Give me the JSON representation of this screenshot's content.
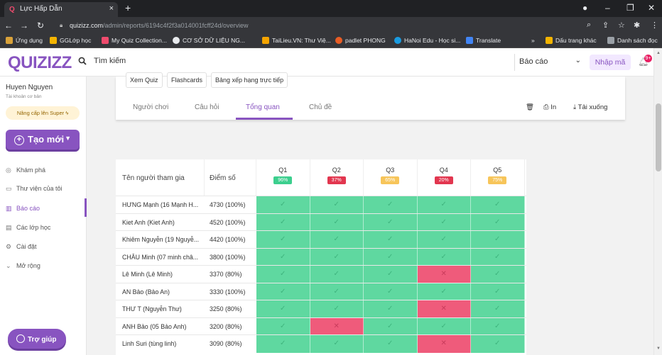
{
  "browser": {
    "tab_title": "Lực Hấp Dẫn",
    "url_host": "quizizz.com",
    "url_path": "/admin/reports/6194c4f2f3a014001fcff24d/overview",
    "bookmarks": [
      "Ứng dụng",
      "GGLớp học",
      "My Quiz Collection...",
      "CƠ SỞ DỮ LIỆU NG...",
      "TaiLieu.VN: Thư Việ...",
      "padlet PHONG",
      "HaNoi Edu - Học si...",
      "Translate",
      "Dấu trang khác",
      "Danh sách đọc"
    ]
  },
  "header": {
    "logo": "QUIZIZZ",
    "search_text": "Tìm kiếm",
    "report_select": "Báo cáo",
    "join_button": "Nhập mã",
    "notification_count": "9+"
  },
  "sidebar": {
    "user_name": "Huyen Nguyen",
    "account_type": "Tài khoản cơ bản",
    "upgrade": "Nâng cấp lên Super",
    "create_button": "Tạo mới",
    "items": [
      {
        "label": "Khám phá",
        "icon": "compass-icon"
      },
      {
        "label": "Thư viện của tôi",
        "icon": "folder-icon"
      },
      {
        "label": "Báo cáo",
        "icon": "chart-icon"
      },
      {
        "label": "Các lớp học",
        "icon": "classroom-icon"
      },
      {
        "label": "Cài đặt",
        "icon": "gear-icon"
      },
      {
        "label": "Mở rộng",
        "icon": "chevron-down-icon"
      }
    ],
    "help_button": "Trợ giúp"
  },
  "report": {
    "chips": [
      "Xem Quiz",
      "Flashcards",
      "Bảng xếp hạng trực tiếp"
    ],
    "tabs": [
      "Người chơi",
      "Câu hỏi",
      "Tổng quan",
      "Chủ đề"
    ],
    "active_tab": "Tổng quan",
    "print_label": "In",
    "download_label": "Tải xuống"
  },
  "table": {
    "col_name": "Tên người tham gia",
    "col_score": "Điểm số",
    "questions": [
      {
        "label": "Q1",
        "pct": "96%",
        "color": "#3ccf8e"
      },
      {
        "label": "Q2",
        "pct": "37%",
        "color": "#e2364f"
      },
      {
        "label": "Q3",
        "pct": "65%",
        "color": "#f7c55a"
      },
      {
        "label": "Q4",
        "pct": "20%",
        "color": "#e2364f"
      },
      {
        "label": "Q5",
        "pct": "75%",
        "color": "#f7c55a"
      }
    ],
    "rows": [
      {
        "name": "HƯNG Mạnh (16 Mạnh H...",
        "score": "4730 (100%)",
        "answers": [
          "ok",
          "ok",
          "ok",
          "ok",
          "ok"
        ]
      },
      {
        "name": "Kiet Anh (Kiet Anh)",
        "score": "4520 (100%)",
        "answers": [
          "ok",
          "ok",
          "ok",
          "ok",
          "ok"
        ]
      },
      {
        "name": "Khiêm Nguyễn (19 Nguyễ...",
        "score": "4420 (100%)",
        "answers": [
          "ok",
          "ok",
          "ok",
          "ok",
          "ok"
        ]
      },
      {
        "name": "CHÂU Minh (07 minh châ...",
        "score": "3800 (100%)",
        "answers": [
          "ok",
          "ok",
          "ok",
          "ok",
          "ok"
        ]
      },
      {
        "name": "Lê Minh (Lê Minh)",
        "score": "3370 (80%)",
        "answers": [
          "ok",
          "ok",
          "ok",
          "bad",
          "ok"
        ]
      },
      {
        "name": "AN Bảo (Bảo An)",
        "score": "3330 (100%)",
        "answers": [
          "ok",
          "ok",
          "ok",
          "ok",
          "ok"
        ]
      },
      {
        "name": "THƯ T (Nguyễn Thư)",
        "score": "3250 (80%)",
        "answers": [
          "ok",
          "ok",
          "ok",
          "bad",
          "ok"
        ]
      },
      {
        "name": "ANH Bảo (05 Bảo Anh)",
        "score": "3200 (80%)",
        "answers": [
          "ok",
          "bad",
          "ok",
          "ok",
          "ok"
        ]
      },
      {
        "name": "Linh Suri (tùng linh)",
        "score": "3090 (80%)",
        "answers": [
          "ok",
          "ok",
          "ok",
          "bad",
          "ok"
        ]
      }
    ]
  }
}
